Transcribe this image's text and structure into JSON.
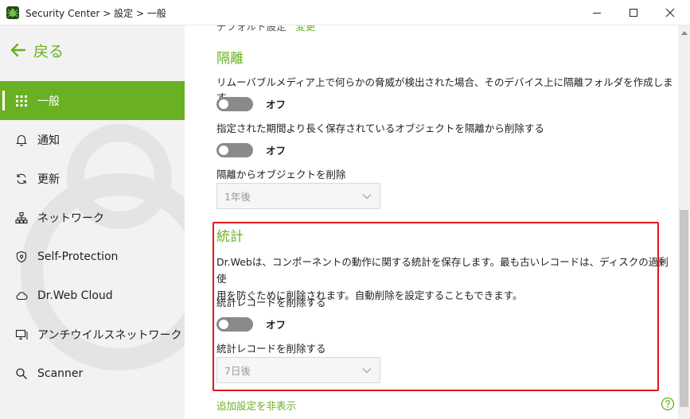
{
  "window": {
    "title": "Security Center > 設定 > 一般",
    "controls": [
      "minimize-icon",
      "maximize-icon",
      "close-icon"
    ]
  },
  "sidebar": {
    "back_label": "戻る",
    "items": [
      {
        "label": "一般",
        "icon": "grid-icon",
        "active": true
      },
      {
        "label": "通知",
        "icon": "bell-icon",
        "active": false
      },
      {
        "label": "更新",
        "icon": "refresh-icon",
        "active": false
      },
      {
        "label": "ネットワーク",
        "icon": "network-icon",
        "active": false
      },
      {
        "label": "Self-Protection",
        "icon": "shield-icon",
        "active": false
      },
      {
        "label": "Dr.Web Cloud",
        "icon": "cloud-icon",
        "active": false
      },
      {
        "label": "アンチウイルスネットワーク",
        "icon": "monitor-icon",
        "active": false
      },
      {
        "label": "Scanner",
        "icon": "search-icon",
        "active": false
      }
    ]
  },
  "content": {
    "top_partial": "デフォルト設定",
    "top_partial_link": "変更",
    "quarantine": {
      "title": "隔離",
      "removable_desc": "リムーバブルメディア上で何らかの脅威が検出された場合、そのデバイス上に隔離フォルダを作成します",
      "removable_toggle": "オフ",
      "old_desc": "指定された期間より長く保存されているオブジェクトを隔離から削除する",
      "old_toggle": "オフ",
      "delete_label": "隔離からオブジェクトを削除",
      "delete_select": "1年後"
    },
    "statistics": {
      "title": "統計",
      "desc_line1": "Dr.Webは、コンポーネントの動作に関する統計を保存します。最も古いレコードは、ディスクの過剰使",
      "desc_line2": "用を防ぐために削除されます。自動削除を設定することもできます。",
      "delete_records_label": "統計レコードを削除する",
      "delete_records_toggle": "オフ",
      "delete_after_label": "統計レコードを削除する",
      "delete_after_select": "7日後"
    },
    "hide_advanced_link": "追加設定を非表示"
  },
  "colors": {
    "accent": "#6ab023",
    "highlight": "#e0161c",
    "sidebar_bg": "#f2f2f2",
    "toggle_off": "#8a8a8a"
  }
}
